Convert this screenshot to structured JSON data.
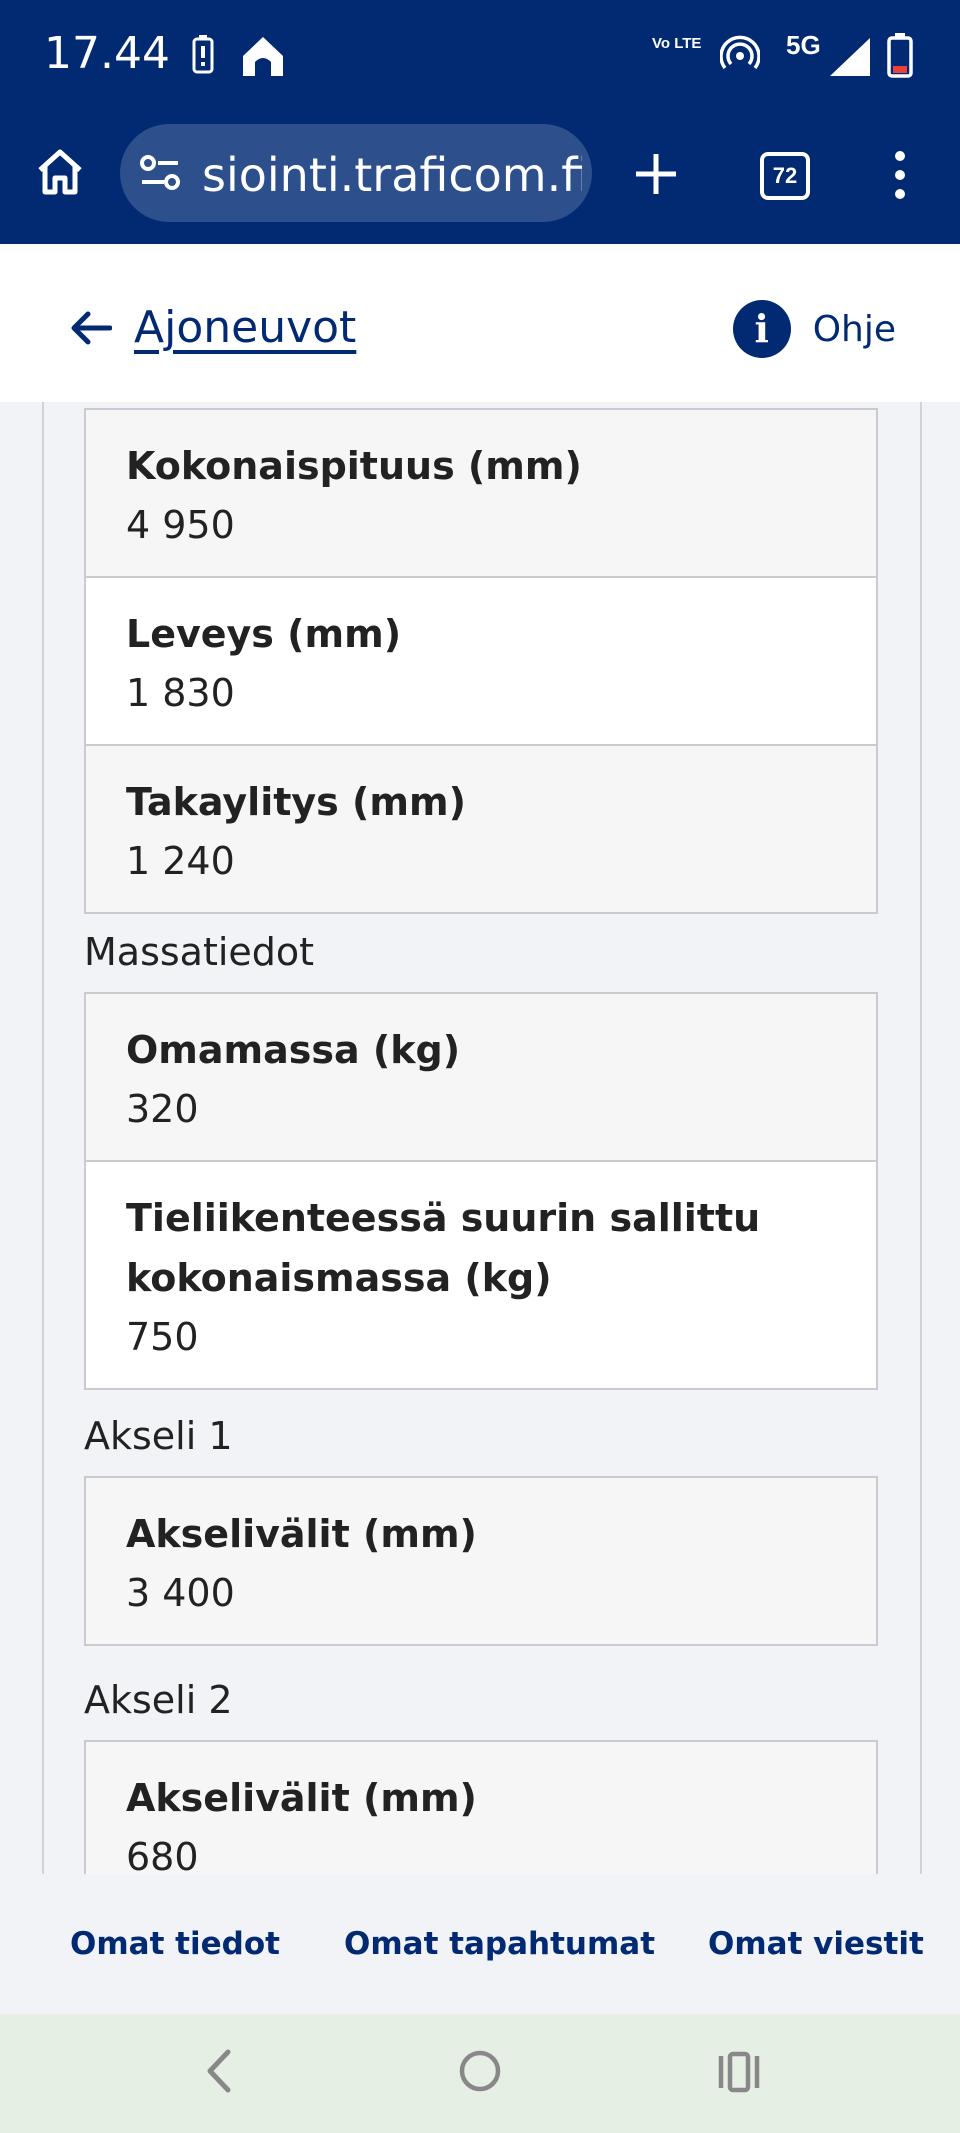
{
  "status_bar": {
    "time": "17.44",
    "icons": [
      "battery-saver-icon",
      "home-app-icon",
      "volte-icon",
      "hotspot-icon",
      "5g-signal-icon",
      "battery-low-icon"
    ],
    "network": "5G",
    "volte": "Vo LTE"
  },
  "browser": {
    "url": "siointi.traficom.fi",
    "tab_count": "72"
  },
  "header": {
    "back_label": "Ajoneuvot",
    "help_label": "Ohje"
  },
  "dimensions": [
    {
      "label": "Kokonaispituus (mm)",
      "value": "4 950"
    },
    {
      "label": "Leveys (mm)",
      "value": "1 830"
    },
    {
      "label": "Takaylitys (mm)",
      "value": "1 240"
    }
  ],
  "mass": {
    "title": "Massatiedot",
    "items": [
      {
        "label": "Omamassa (kg)",
        "value": "320"
      },
      {
        "label": "Tieliikenteessä suurin sallittu kokonaismassa (kg)",
        "value": "750"
      }
    ]
  },
  "axle1": {
    "title": "Akseli 1",
    "items": [
      {
        "label": "Akselivälit (mm)",
        "value": "3 400"
      }
    ]
  },
  "axle2": {
    "title": "Akseli 2",
    "items": [
      {
        "label": "Akselivälit (mm)",
        "value": "680"
      }
    ]
  },
  "bottom_nav": [
    "Omat tiedot",
    "Omat tapahtumat",
    "Omat viestit"
  ]
}
